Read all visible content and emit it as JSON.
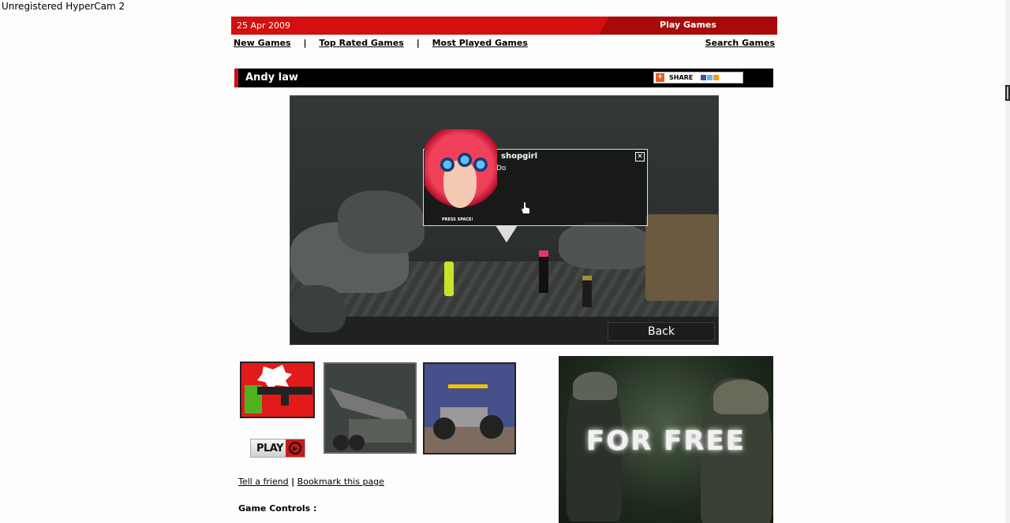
{
  "watermark": "Unregistered HyperCam 2",
  "header": {
    "date": "25 Apr 2009",
    "play_games": "Play Games"
  },
  "nav": {
    "items": [
      "New Games",
      "Top Rated Games",
      "Most Played Games"
    ],
    "separator": "|",
    "search": "Search Games"
  },
  "game": {
    "title": "Andy law",
    "share_label": "SHARE",
    "dialog_name": "shopgirl",
    "dialog_text": "Do",
    "press_space": "PRESS SPACE!",
    "close_icon": "✕",
    "back_label": "Back"
  },
  "play_button": {
    "label": "PLAY",
    "icon": "▶"
  },
  "links": {
    "tell_friend": "Tell a friend",
    "separator": "|",
    "bookmark": "Bookmark this page"
  },
  "controls_label": "Game Controls :",
  "ad": {
    "text": "FOR FREE"
  }
}
